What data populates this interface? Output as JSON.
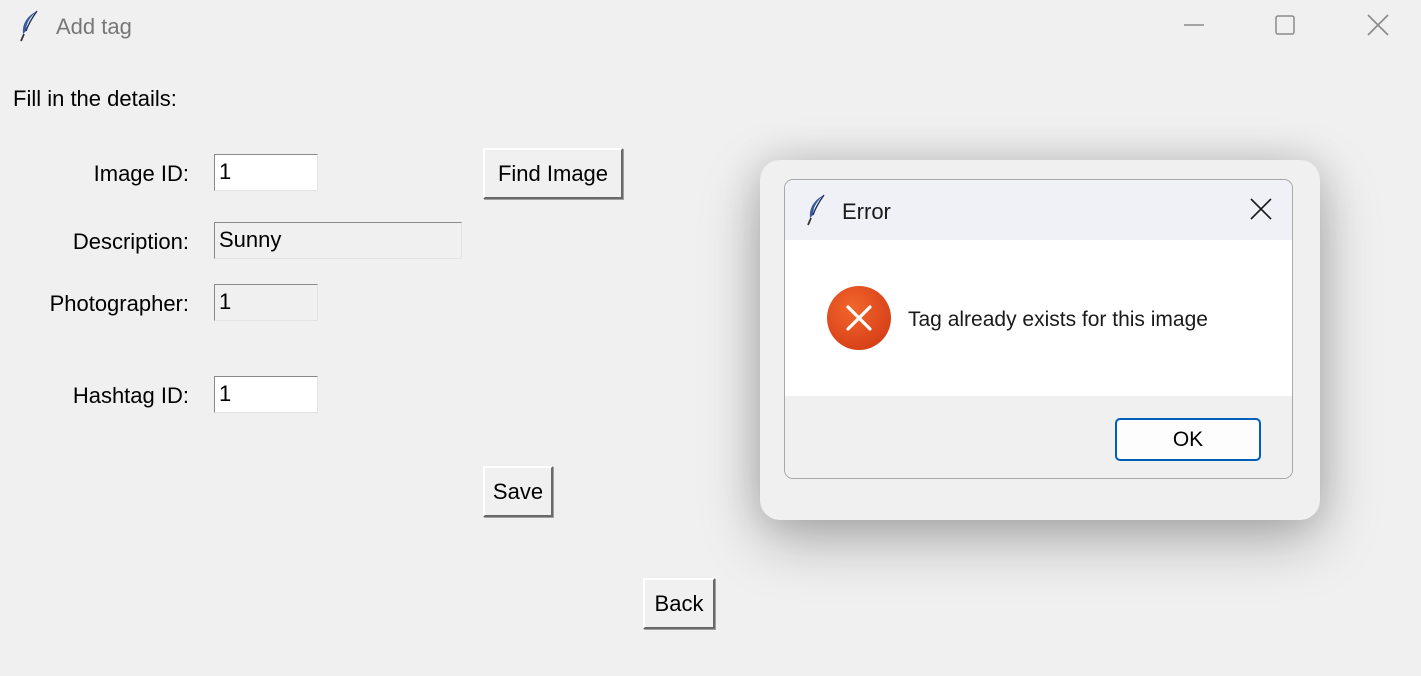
{
  "window": {
    "title": "Add tag",
    "icon": "feather-icon",
    "controls": [
      "minimize-icon",
      "maximize-icon",
      "close-icon"
    ]
  },
  "form": {
    "instruction": "Fill in the details:",
    "image_id_label": "Image ID:",
    "image_id_value": "1",
    "find_image_label": "Find Image",
    "description_label": "Description:",
    "description_value": "Sunny",
    "photographer_label": "Photographer:",
    "photographer_value": "1",
    "hashtag_id_label": "Hashtag ID:",
    "hashtag_id_value": "1",
    "save_label": "Save",
    "back_label": "Back"
  },
  "dialog": {
    "title": "Error",
    "icon": "error-icon",
    "message": "Tag already exists for this image",
    "ok_label": "OK",
    "accent_color": "#005fb8",
    "error_color": "#d9431a"
  }
}
